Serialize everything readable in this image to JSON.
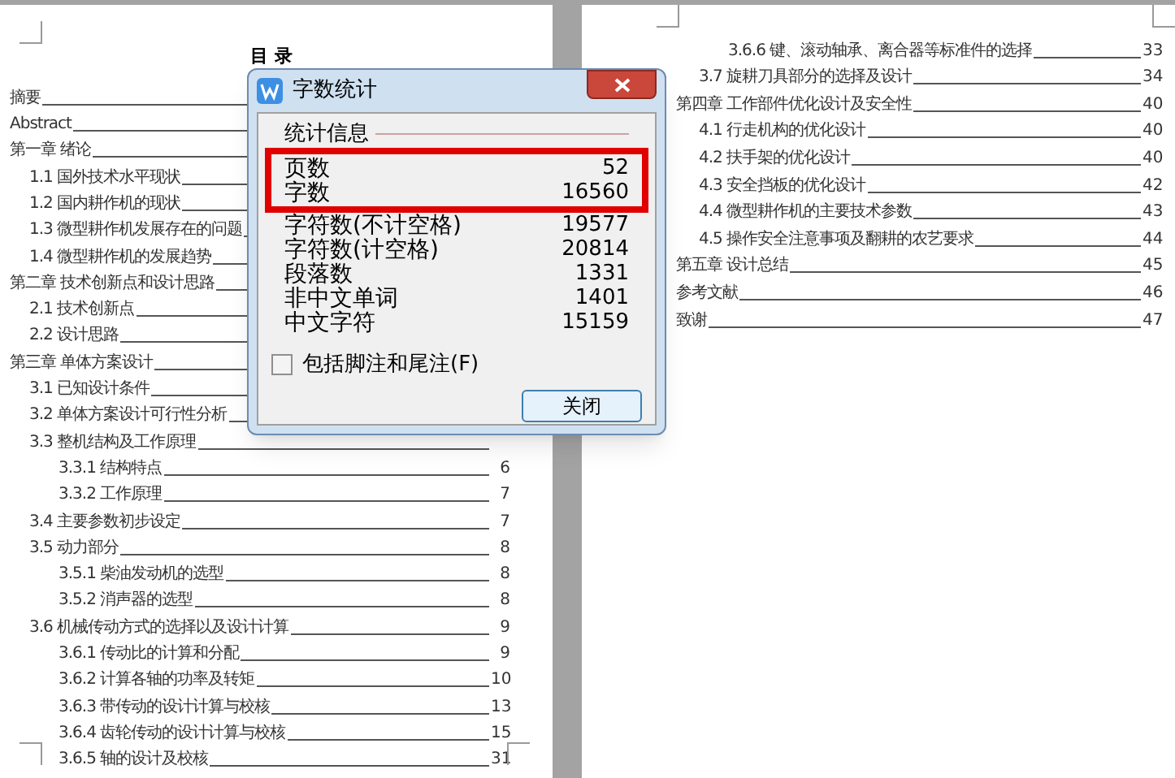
{
  "left_page": {
    "title": "目 录",
    "entries": [
      {
        "label": "摘要"
      },
      {
        "label": "Abstract"
      },
      {
        "label": "第一章 绪论",
        "children": [
          {
            "label": "1.1 国外技术水平现状"
          },
          {
            "label": "1.2 国内耕作机的现状"
          },
          {
            "label": "1.3 微型耕作机发展存在的问题"
          },
          {
            "label": "1.4 微型耕作机的发展趋势"
          }
        ]
      },
      {
        "label": "第二章 技术创新点和设计思路",
        "children": [
          {
            "label": "2.1 技术创新点"
          },
          {
            "label": "2.2 设计思路"
          }
        ]
      },
      {
        "label": "第三章 单体方案设计",
        "children": [
          {
            "label": "3.1 已知设计条件"
          },
          {
            "label": "3.2 单体方案设计可行性分析"
          },
          {
            "label": "3.3 整机结构及工作原理",
            "children": [
              {
                "label": "3.3.1 结构特点",
                "page": "6"
              },
              {
                "label": "3.3.2 工作原理",
                "page": "7"
              }
            ]
          },
          {
            "label": "3.4 主要参数初步设定",
            "page": "7"
          },
          {
            "label": "3.5 动力部分",
            "page": "8",
            "children": [
              {
                "label": "3.5.1 柴油发动机的选型",
                "page": "8"
              },
              {
                "label": "3.5.2 消声器的选型",
                "page": "8"
              }
            ]
          },
          {
            "label": "3.6 机械传动方式的选择以及设计计算",
            "page": "9",
            "children": [
              {
                "label": "3.6.1 传动比的计算和分配",
                "page": "9"
              },
              {
                "label": "3.6.2 计算各轴的功率及转矩",
                "page": "10"
              },
              {
                "label": "3.6.3 带传动的设计计算与校核",
                "page": "13"
              },
              {
                "label": "3.6.4 齿轮传动的设计计算与校核",
                "page": "15"
              },
              {
                "label": "3.6.5 轴的设计及校核",
                "page": "31"
              }
            ]
          }
        ]
      }
    ]
  },
  "right_page": {
    "entries": [
      {
        "children": [
          {
            "children": [
              {
                "label": "3.6.6 键、滚动轴承、离合器等标准件的选择",
                "page": "33"
              }
            ]
          },
          {
            "label": "3.7 旋耕刀具部分的选择及设计",
            "page": "34"
          }
        ]
      },
      {
        "label": "第四章 工作部件优化设计及安全性",
        "page": "40",
        "children": [
          {
            "label": "4.1 行走机构的优化设计",
            "page": "40"
          },
          {
            "label": "4.2 扶手架的优化设计",
            "page": "40"
          },
          {
            "label": "4.3 安全挡板的优化设计",
            "page": "42"
          },
          {
            "label": "4.4 微型耕作机的主要技术参数",
            "page": "43"
          },
          {
            "label": "4.5 操作安全注意事项及翻耕的农艺要求",
            "page": "44"
          }
        ]
      },
      {
        "label": "第五章 设计总结",
        "page": "45"
      },
      {
        "label": "参考文献",
        "page": "46"
      },
      {
        "label": "致谢",
        "page": "47"
      }
    ]
  },
  "dialog": {
    "title": "字数统计",
    "group_label": "统计信息",
    "stats": [
      {
        "label": "页数",
        "value": "52",
        "highlighted": true
      },
      {
        "label": "字数",
        "value": "16560",
        "highlighted": true
      },
      {
        "label": "字符数(不计空格)",
        "value": "19577",
        "highlighted": false
      },
      {
        "label": "字符数(计空格)",
        "value": "20814",
        "highlighted": false
      },
      {
        "label": "段落数",
        "value": "1331",
        "highlighted": false
      },
      {
        "label": "非中文单词",
        "value": "1401",
        "highlighted": false
      },
      {
        "label": "中文字符",
        "value": "15159",
        "highlighted": false
      }
    ],
    "checkbox": {
      "label": "包括脚注和尾注(F)",
      "checked": false
    },
    "button": "关闭"
  }
}
